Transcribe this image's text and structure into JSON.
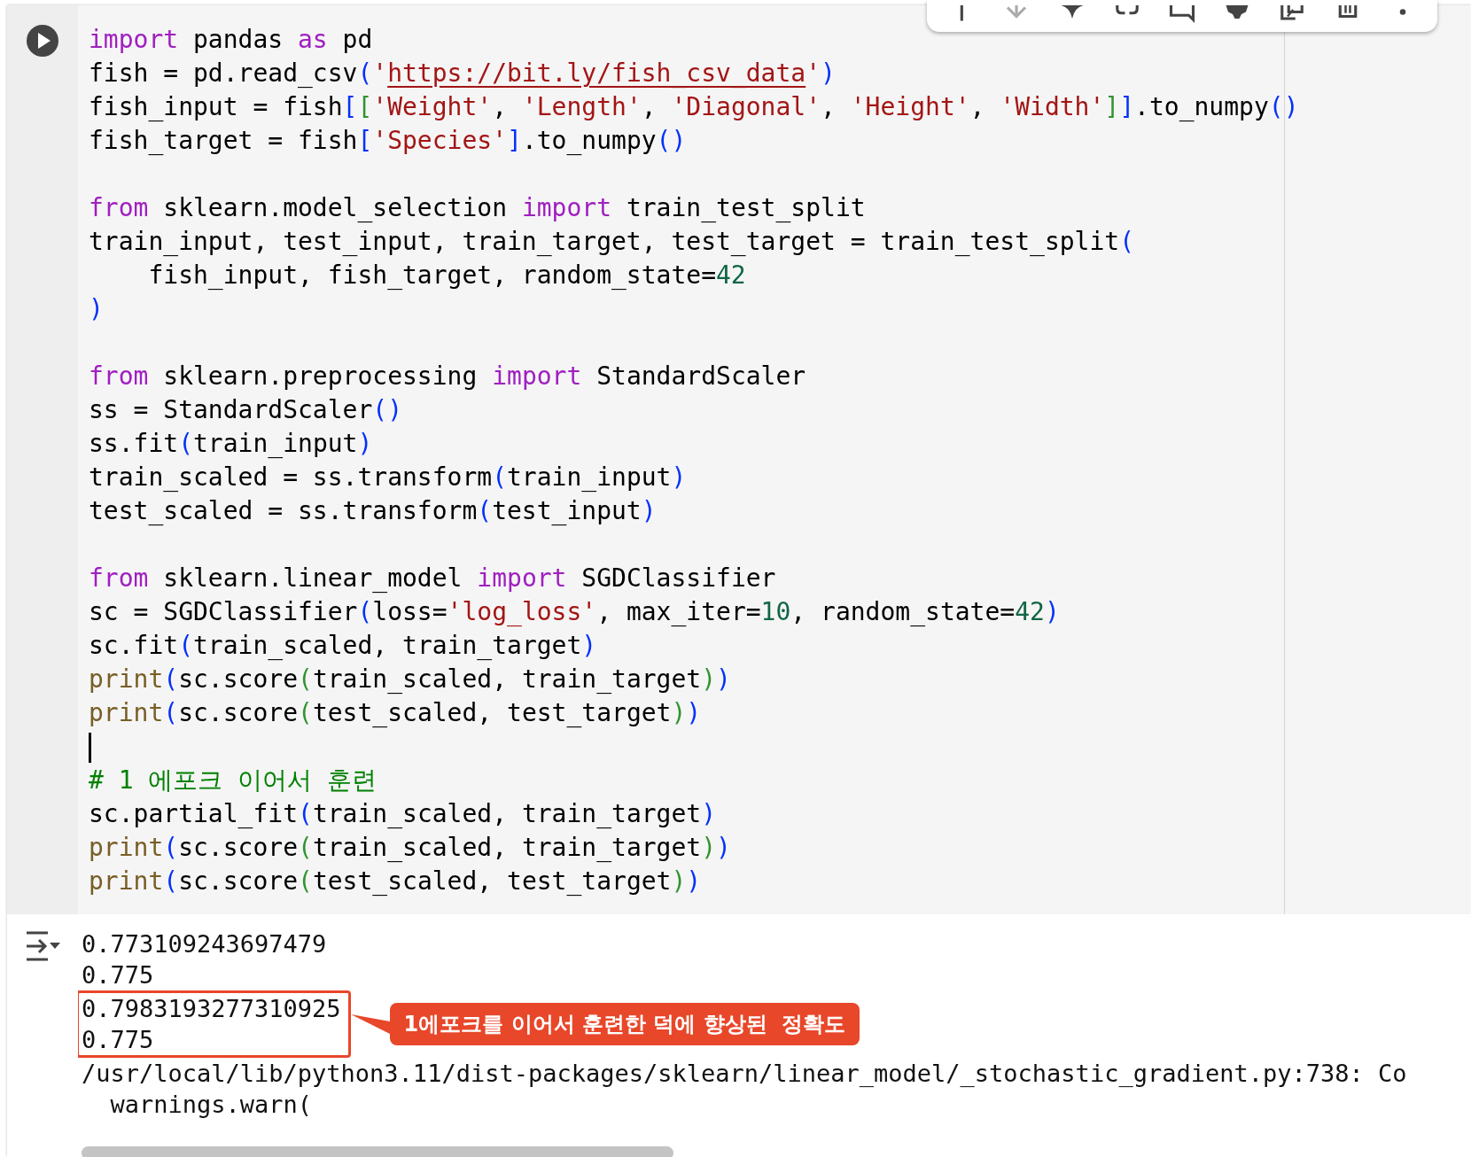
{
  "code_lines": [
    {
      "kind": "code",
      "tokens": [
        {
          "kind": "kw",
          "text": "import"
        },
        {
          "kind": "p",
          "text": " pandas "
        },
        {
          "kind": "kw",
          "text": "as"
        },
        {
          "kind": "p",
          "text": " pd"
        }
      ]
    },
    {
      "kind": "code",
      "tokens": [
        {
          "kind": "p",
          "text": "fish = pd.read_csv"
        },
        {
          "kind": "b1",
          "text": "("
        },
        {
          "kind": "s",
          "text": "'"
        },
        {
          "kind": "url",
          "text": "https://bit.ly/fish_csv_data"
        },
        {
          "kind": "s",
          "text": "'"
        },
        {
          "kind": "b1",
          "text": ")"
        }
      ]
    },
    {
      "kind": "code",
      "tokens": [
        {
          "kind": "p",
          "text": "fish_input = fish"
        },
        {
          "kind": "b1",
          "text": "["
        },
        {
          "kind": "b2",
          "text": "["
        },
        {
          "kind": "s",
          "text": "'Weight'"
        },
        {
          "kind": "p",
          "text": ", "
        },
        {
          "kind": "s",
          "text": "'Length'"
        },
        {
          "kind": "p",
          "text": ", "
        },
        {
          "kind": "s",
          "text": "'Diagonal'"
        },
        {
          "kind": "p",
          "text": ", "
        },
        {
          "kind": "s",
          "text": "'Height'"
        },
        {
          "kind": "p",
          "text": ", "
        },
        {
          "kind": "s",
          "text": "'Width'"
        },
        {
          "kind": "b2",
          "text": "]"
        },
        {
          "kind": "b1",
          "text": "]"
        },
        {
          "kind": "p",
          "text": ".to_numpy"
        },
        {
          "kind": "b1",
          "text": "()"
        }
      ]
    },
    {
      "kind": "code",
      "tokens": [
        {
          "kind": "p",
          "text": "fish_target = fish"
        },
        {
          "kind": "b1",
          "text": "["
        },
        {
          "kind": "s",
          "text": "'Species'"
        },
        {
          "kind": "b1",
          "text": "]"
        },
        {
          "kind": "p",
          "text": ".to_numpy"
        },
        {
          "kind": "b1",
          "text": "()"
        }
      ]
    },
    {
      "kind": "blank"
    },
    {
      "kind": "code",
      "tokens": [
        {
          "kind": "kw",
          "text": "from"
        },
        {
          "kind": "p",
          "text": " sklearn.model_selection "
        },
        {
          "kind": "kw",
          "text": "import"
        },
        {
          "kind": "p",
          "text": " train_test_split"
        }
      ]
    },
    {
      "kind": "code",
      "tokens": [
        {
          "kind": "p",
          "text": "train_input, test_input, train_target, test_target = train_test_split"
        },
        {
          "kind": "b1",
          "text": "("
        }
      ]
    },
    {
      "kind": "code",
      "tokens": [
        {
          "kind": "p",
          "text": "    fish_input, fish_target, random_state="
        },
        {
          "kind": "n",
          "text": "42"
        }
      ]
    },
    {
      "kind": "code",
      "tokens": [
        {
          "kind": "b1",
          "text": ")"
        }
      ]
    },
    {
      "kind": "blank"
    },
    {
      "kind": "code",
      "tokens": [
        {
          "kind": "kw",
          "text": "from"
        },
        {
          "kind": "p",
          "text": " sklearn.preprocessing "
        },
        {
          "kind": "kw",
          "text": "import"
        },
        {
          "kind": "p",
          "text": " StandardScaler"
        }
      ]
    },
    {
      "kind": "code",
      "tokens": [
        {
          "kind": "p",
          "text": "ss = StandardScaler"
        },
        {
          "kind": "b1",
          "text": "()"
        }
      ]
    },
    {
      "kind": "code",
      "tokens": [
        {
          "kind": "p",
          "text": "ss.fit"
        },
        {
          "kind": "b1",
          "text": "("
        },
        {
          "kind": "p",
          "text": "train_input"
        },
        {
          "kind": "b1",
          "text": ")"
        }
      ]
    },
    {
      "kind": "code",
      "tokens": [
        {
          "kind": "p",
          "text": "train_scaled = ss.transform"
        },
        {
          "kind": "b1",
          "text": "("
        },
        {
          "kind": "p",
          "text": "train_input"
        },
        {
          "kind": "b1",
          "text": ")"
        }
      ]
    },
    {
      "kind": "code",
      "tokens": [
        {
          "kind": "p",
          "text": "test_scaled = ss.transform"
        },
        {
          "kind": "b1",
          "text": "("
        },
        {
          "kind": "p",
          "text": "test_input"
        },
        {
          "kind": "b1",
          "text": ")"
        }
      ]
    },
    {
      "kind": "blank"
    },
    {
      "kind": "code",
      "tokens": [
        {
          "kind": "kw",
          "text": "from"
        },
        {
          "kind": "p",
          "text": " sklearn.linear_model "
        },
        {
          "kind": "kw",
          "text": "import"
        },
        {
          "kind": "p",
          "text": " SGDClassifier"
        }
      ]
    },
    {
      "kind": "code",
      "tokens": [
        {
          "kind": "p",
          "text": "sc = SGDClassifier"
        },
        {
          "kind": "b1",
          "text": "("
        },
        {
          "kind": "p",
          "text": "loss="
        },
        {
          "kind": "s",
          "text": "'log_loss'"
        },
        {
          "kind": "p",
          "text": ", max_iter="
        },
        {
          "kind": "n",
          "text": "10"
        },
        {
          "kind": "p",
          "text": ", random_state="
        },
        {
          "kind": "n",
          "text": "42"
        },
        {
          "kind": "b1",
          "text": ")"
        }
      ]
    },
    {
      "kind": "code",
      "tokens": [
        {
          "kind": "p",
          "text": "sc.fit"
        },
        {
          "kind": "b1",
          "text": "("
        },
        {
          "kind": "p",
          "text": "train_scaled, train_target"
        },
        {
          "kind": "b1",
          "text": ")"
        }
      ]
    },
    {
      "kind": "code",
      "tokens": [
        {
          "kind": "f",
          "text": "print"
        },
        {
          "kind": "b1",
          "text": "("
        },
        {
          "kind": "p",
          "text": "sc.score"
        },
        {
          "kind": "b2",
          "text": "("
        },
        {
          "kind": "p",
          "text": "train_scaled, train_target"
        },
        {
          "kind": "b2",
          "text": ")"
        },
        {
          "kind": "b1",
          "text": ")"
        }
      ]
    },
    {
      "kind": "code",
      "tokens": [
        {
          "kind": "f",
          "text": "print"
        },
        {
          "kind": "b1",
          "text": "("
        },
        {
          "kind": "p",
          "text": "sc.score"
        },
        {
          "kind": "b2",
          "text": "("
        },
        {
          "kind": "p",
          "text": "test_scaled, test_target"
        },
        {
          "kind": "b2",
          "text": ")"
        },
        {
          "kind": "b1",
          "text": ")"
        }
      ]
    },
    {
      "kind": "cursor"
    },
    {
      "kind": "code",
      "tokens": [
        {
          "kind": "c",
          "text": "# 1 에포크 이어서 훈련"
        }
      ]
    },
    {
      "kind": "code",
      "tokens": [
        {
          "kind": "p",
          "text": "sc.partial_fit"
        },
        {
          "kind": "b1",
          "text": "("
        },
        {
          "kind": "p",
          "text": "train_scaled, train_target"
        },
        {
          "kind": "b1",
          "text": ")"
        }
      ]
    },
    {
      "kind": "code",
      "tokens": [
        {
          "kind": "f",
          "text": "print"
        },
        {
          "kind": "b1",
          "text": "("
        },
        {
          "kind": "p",
          "text": "sc.score"
        },
        {
          "kind": "b2",
          "text": "("
        },
        {
          "kind": "p",
          "text": "train_scaled, train_target"
        },
        {
          "kind": "b2",
          "text": ")"
        },
        {
          "kind": "b1",
          "text": ")"
        }
      ]
    },
    {
      "kind": "code",
      "tokens": [
        {
          "kind": "f",
          "text": "print"
        },
        {
          "kind": "b1",
          "text": "("
        },
        {
          "kind": "p",
          "text": "sc.score"
        },
        {
          "kind": "b2",
          "text": "("
        },
        {
          "kind": "p",
          "text": "test_scaled, test_target"
        },
        {
          "kind": "b2",
          "text": ")"
        },
        {
          "kind": "b1",
          "text": ")"
        }
      ]
    }
  ],
  "output": {
    "lines_before": [
      "0.773109243697479",
      "0.775"
    ],
    "highlighted": [
      "0.7983193277310925",
      "0.775"
    ],
    "callout": "1에포크를 이어서 훈련한 덕에 향상된  정확도",
    "lines_after": [
      "/usr/local/lib/python3.11/dist-packages/sklearn/linear_model/_stochastic_gradient.py:738: Co",
      "  warnings.warn("
    ]
  }
}
